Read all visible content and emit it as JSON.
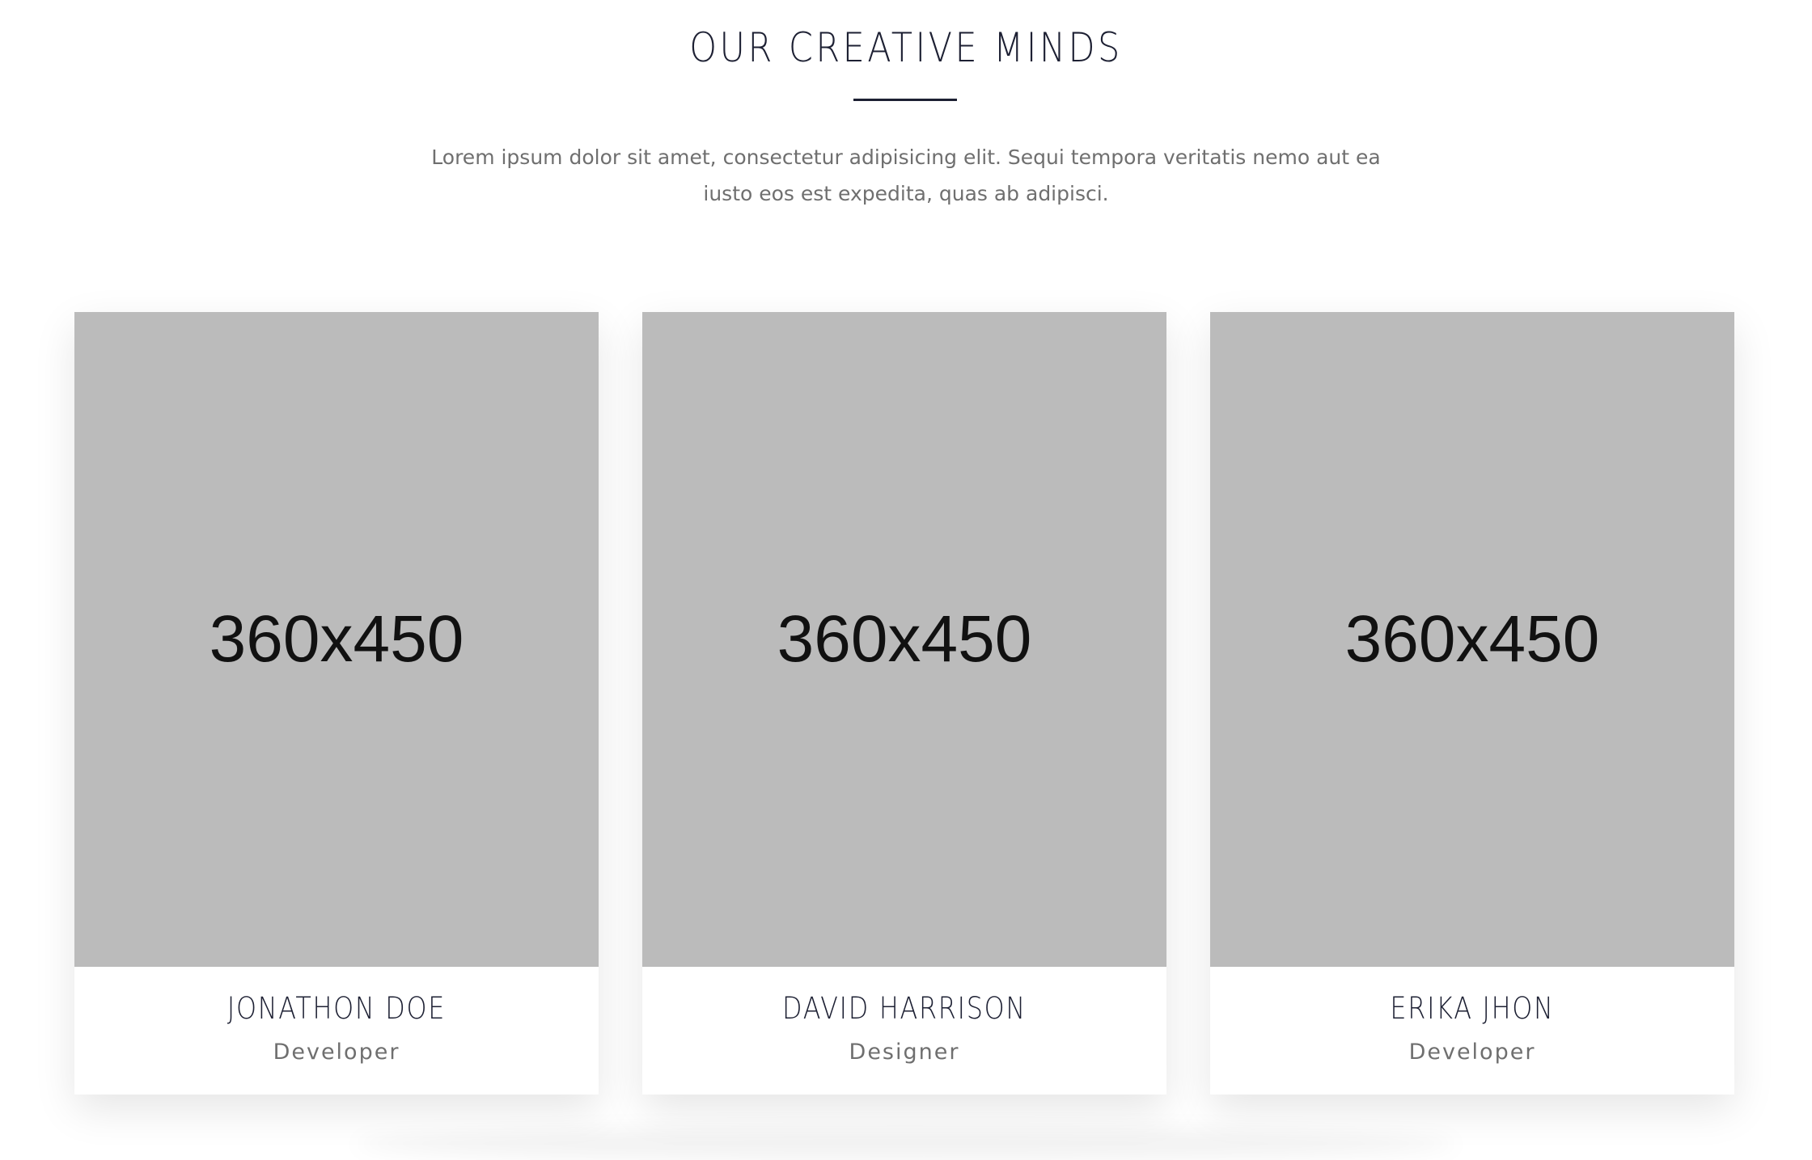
{
  "section": {
    "title": "OUR CREATIVE MINDS",
    "description": "Lorem ipsum dolor sit amet, consectetur adipisicing elit. Sequi tempora veritatis nemo aut ea iusto eos est expedita, quas ab adipisci."
  },
  "team": [
    {
      "photo_placeholder": "360x450",
      "name": "JONATHON DOE",
      "role": "Developer"
    },
    {
      "photo_placeholder": "360x450",
      "name": "DAVID HARRISON",
      "role": "Designer"
    },
    {
      "photo_placeholder": "360x450",
      "name": "ERIKA JHON",
      "role": "Developer"
    }
  ],
  "colors": {
    "heading": "#1d2033",
    "body_text": "#6f6f6f",
    "placeholder_bg": "#bbbbbb",
    "background": "#ffffff"
  }
}
